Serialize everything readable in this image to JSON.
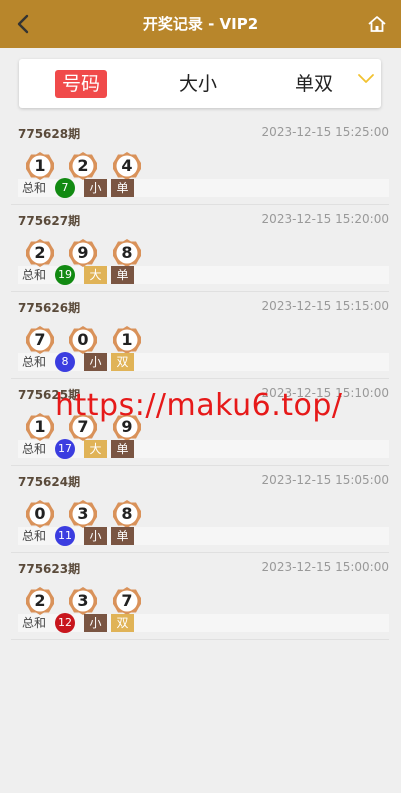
{
  "header": {
    "title": "开奖记录 - VIP2",
    "back_icon": "chevron-left-icon",
    "home_icon": "home-icon"
  },
  "tabs": {
    "number": "号码",
    "size": "大小",
    "parity": "单双",
    "active": "number",
    "dropdown_icon": "chevron-down-icon"
  },
  "sum_label": "总和",
  "colors": {
    "header": "#b8862b",
    "active_tab": "#f04a4a",
    "green": "#128a12",
    "blue": "#3b3de0",
    "red": "#c8161d",
    "tag_dark": "#7a5542",
    "tag_light": "#e0b357"
  },
  "rows": [
    {
      "issue": "775628期",
      "time": "2023-12-15 15:25:00",
      "nums": [
        "1",
        "2",
        "4"
      ],
      "sum": "7",
      "sum_color": "#128a12",
      "size": "小",
      "size_color": "#7a5542",
      "parity": "单",
      "parity_color": "#7a5542"
    },
    {
      "issue": "775627期",
      "time": "2023-12-15 15:20:00",
      "nums": [
        "2",
        "9",
        "8"
      ],
      "sum": "19",
      "sum_color": "#128a12",
      "size": "大",
      "size_color": "#e0b357",
      "parity": "单",
      "parity_color": "#7a5542"
    },
    {
      "issue": "775626期",
      "time": "2023-12-15 15:15:00",
      "nums": [
        "7",
        "0",
        "1"
      ],
      "sum": "8",
      "sum_color": "#3b3de0",
      "size": "小",
      "size_color": "#7a5542",
      "parity": "双",
      "parity_color": "#e0b357"
    },
    {
      "issue": "775625期",
      "time": "2023-12-15 15:10:00",
      "nums": [
        "1",
        "7",
        "9"
      ],
      "sum": "17",
      "sum_color": "#3b3de0",
      "size": "大",
      "size_color": "#e0b357",
      "parity": "单",
      "parity_color": "#7a5542"
    },
    {
      "issue": "775624期",
      "time": "2023-12-15 15:05:00",
      "nums": [
        "0",
        "3",
        "8"
      ],
      "sum": "11",
      "sum_color": "#3b3de0",
      "size": "小",
      "size_color": "#7a5542",
      "parity": "单",
      "parity_color": "#7a5542"
    },
    {
      "issue": "775623期",
      "time": "2023-12-15 15:00:00",
      "nums": [
        "2",
        "3",
        "7"
      ],
      "sum": "12",
      "sum_color": "#c8161d",
      "size": "小",
      "size_color": "#7a5542",
      "parity": "双",
      "parity_color": "#e0b357"
    }
  ],
  "watermark": "https://maku6.top/"
}
